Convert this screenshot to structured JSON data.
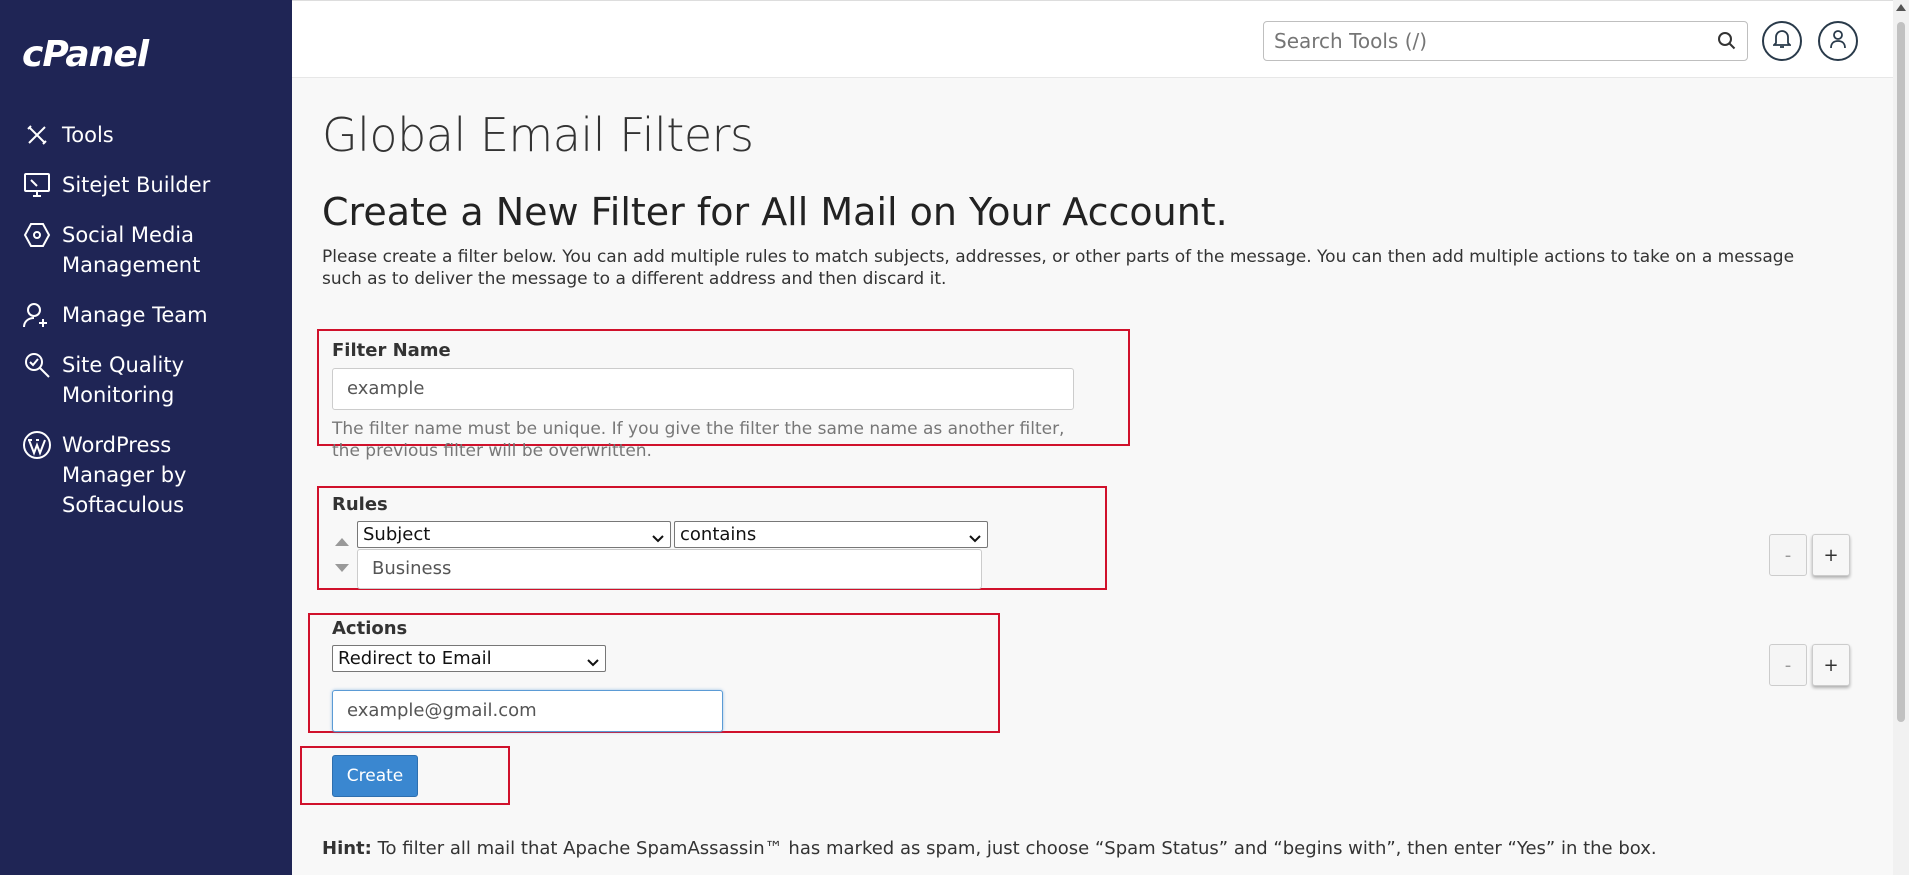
{
  "app": {
    "logo": "cPanel"
  },
  "sidebar": {
    "items": [
      {
        "label": "Tools",
        "icon": "tools-icon"
      },
      {
        "label": "Sitejet Builder",
        "icon": "monitor-icon"
      },
      {
        "label": "Social Media\nManagement",
        "icon": "social-icon"
      },
      {
        "label": "Manage Team",
        "icon": "user-add-icon"
      },
      {
        "label": "Site Quality\nMonitoring",
        "icon": "magnifier-check-icon"
      },
      {
        "label": "WordPress\n Manager by\nSoftaculous",
        "icon": "wordpress-icon"
      }
    ]
  },
  "header": {
    "search_placeholder": "Search Tools (/)",
    "search_icon": "search-icon",
    "notifications_icon": "bell-icon",
    "user_icon": "user-icon"
  },
  "main": {
    "page_title": "Global Email Filters",
    "section_title": "Create a New Filter for All Mail on Your Account.",
    "intro": "Please create a filter below. You can add multiple rules to match subjects, addresses, or other parts of the message. You can then add multiple actions to take on a message such as to deliver the message to a different address and then discard it.",
    "filter_name": {
      "label": "Filter Name",
      "value": "example",
      "help": "The filter name must be unique. If you give the filter the same name as another filter, the previous filter will be overwritten."
    },
    "rules": {
      "label": "Rules",
      "field_select": "Subject",
      "match_select": "contains",
      "value": "Business",
      "minus": "-",
      "plus": "+"
    },
    "actions": {
      "label": "Actions",
      "action_select": "Redirect to Email",
      "value": "example@gmail.com",
      "minus": "-",
      "plus": "+"
    },
    "create_button": "Create",
    "hint_label": "Hint:",
    "hint_text": " To filter all mail that Apache SpamAssassin™ has marked as spam, just choose “Spam Status” and “begins with”, then enter “Yes” in the box."
  },
  "colors": {
    "sidebar_bg": "#1f2555",
    "highlight_border": "#d0112b",
    "primary_button": "#3a87d0"
  }
}
